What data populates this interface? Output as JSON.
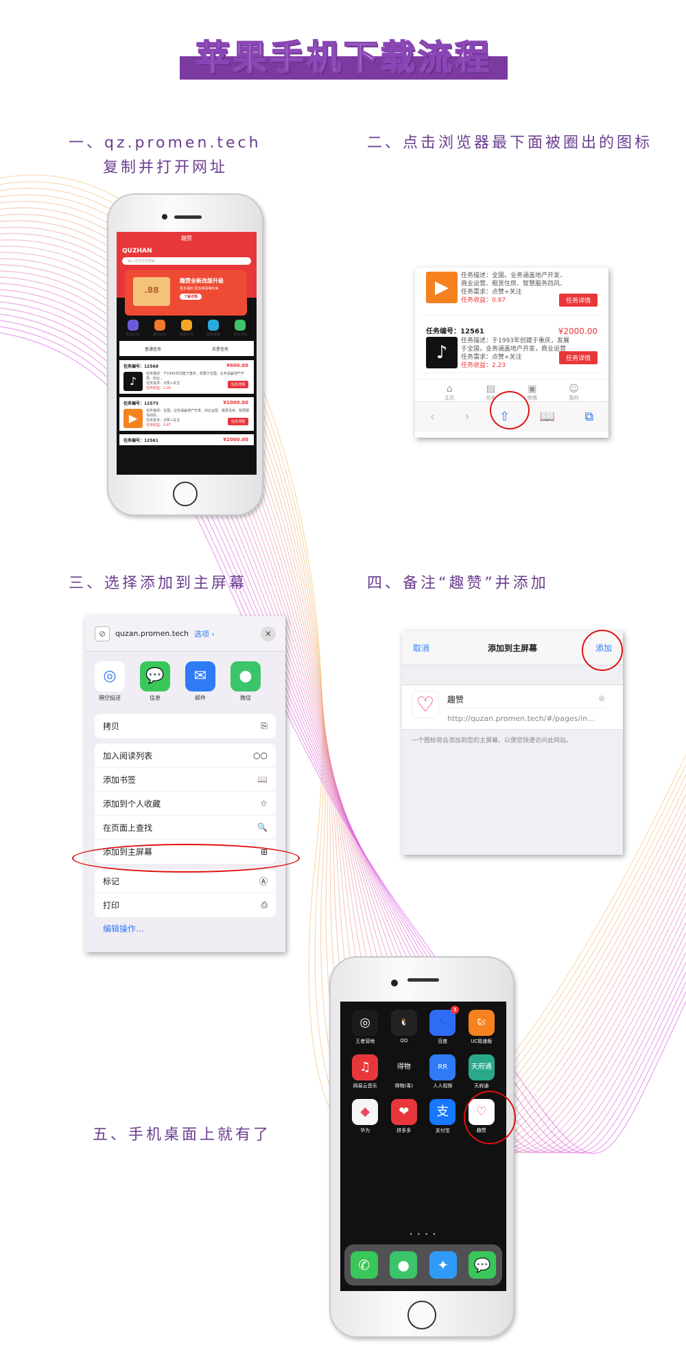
{
  "title": "苹果手机下载流程",
  "steps": {
    "s1a": "一、qz.promen.tech",
    "s1b": "复制并打开网址",
    "s2": "二、点击浏览器最下面被圈出的图标",
    "s3": "三、选择添加到主屏幕",
    "s4": "四、备注“趣赞”并添加",
    "s5": "五、手机桌面上就有了"
  },
  "phone1": {
    "header_title": "趣赞",
    "brand": "QUZHAN",
    "search_placeholder": "输入任务名称搜索",
    "banner_title": "趣赞全新改版升级",
    "banner_sub": "更多福利 更多惊喜等你来",
    "banner_btn": "了解详情",
    "banner_box": ".88",
    "icons": [
      {
        "label": "新闻公告",
        "color": "#6a5bd8"
      },
      {
        "label": "邀请好友",
        "color": "#f07a2c"
      },
      {
        "label": "赛趣专场",
        "color": "#f5a623"
      },
      {
        "label": "联系客服",
        "color": "#29a9e0"
      },
      {
        "label": "更多活动",
        "color": "#3cc46a"
      }
    ],
    "tabs": [
      "普通任务",
      "巨星任务"
    ],
    "tasks": [
      {
        "no": "任务编号：12568",
        "price": "¥600.00",
        "d1": "任务描述：于1993年创建于重庆，发展于全国，业务涵盖地产开发、商业...",
        "d2": "任务需求：点赞+关注",
        "d3": "任务收益：1.00",
        "btn": "任务详情",
        "icon": "♪",
        "color": "#111"
      },
      {
        "no": "任务编号：12575",
        "price": "¥1000.00",
        "d1": "任务描述：全国。业务涵盖地产开发、商业运营、租赁住房、智慧服务四风...",
        "d2": "任务需求：点赞+关注",
        "d3": "任务收益：0.87",
        "btn": "任务详情",
        "icon": "▶",
        "color": "#f5821f"
      },
      {
        "no": "任务编号：12561",
        "price": "¥2000.00"
      }
    ]
  },
  "panel2": {
    "tasks": [
      {
        "d1": "任务描述：全国。业务涵盖地产开发、",
        "d1b": "商业运营、租赁住房、智慧服务四风、",
        "d2": "任务需求：点赞+关注",
        "d3": "任务收益：0.87",
        "btn": "任务详情",
        "icon": "▶",
        "color": "#f5821f"
      },
      {
        "no": "任务编号：12561",
        "price": "¥2000.00",
        "d1": "任务描述：于1993年创建于重庆，发展",
        "d1b": "于全国，业务涵盖地产开发，商业运营",
        "d2": "任务需求：点赞+关注",
        "d3": "任务收益：2.23",
        "btn": "任务详情",
        "icon": "♪",
        "color": "#111"
      }
    ],
    "nav": [
      "主页",
      "任务",
      "商城",
      "我的"
    ],
    "browser": {
      "back": "‹",
      "fwd": "›",
      "share": "⇧",
      "books": "📖",
      "tabs": "⧉"
    }
  },
  "panel3": {
    "url": "quzan.promen.tech",
    "options": "选项 ›",
    "close": "✕",
    "apps": [
      {
        "label": "隔空投送",
        "icon": "◎",
        "color": "#2f7bf6"
      },
      {
        "label": "信息",
        "icon": "💬",
        "color": "#39c75a"
      },
      {
        "label": "邮件",
        "icon": "✉",
        "color": "#2f7bf6"
      },
      {
        "label": "微信",
        "icon": "●",
        "color": "#3cc46a"
      }
    ],
    "g1": [
      {
        "label": "拷贝",
        "icon": "⎘"
      }
    ],
    "g2": [
      {
        "label": "加入阅读列表",
        "icon": "○○"
      },
      {
        "label": "添加书签",
        "icon": "📖"
      },
      {
        "label": "添加到个人收藏",
        "icon": "☆"
      },
      {
        "label": "在页面上查找",
        "icon": "🔍"
      },
      {
        "label": "添加到主屏幕",
        "icon": "⊞"
      }
    ],
    "g3": [
      {
        "label": "标记",
        "icon": "Ⓐ"
      },
      {
        "label": "打印",
        "icon": "⎙"
      }
    ],
    "edit": "编辑操作..."
  },
  "panel4": {
    "cancel": "取消",
    "title": "添加到主屏幕",
    "add": "添加",
    "name": "趣赞",
    "url": "http://quzan.promen.tech/#/pages/in...",
    "hint": "一个图标将会添加到您的主屏幕，以便您快速访问此网站。"
  },
  "phone2": {
    "apps": [
      {
        "label": "王者营地",
        "icon": "◎",
        "color": "#1b1b1b"
      },
      {
        "label": "QQ",
        "icon": "🐧",
        "color": "#222"
      },
      {
        "label": "百度",
        "icon": "🐾",
        "color": "#2f6cf6",
        "badge": "1"
      },
      {
        "label": "UC极速版",
        "icon": "🐿",
        "color": "#f5821f"
      },
      {
        "label": "网易云音乐",
        "icon": "♫",
        "color": "#e8373a"
      },
      {
        "label": "得物(毒)",
        "icon": "得物",
        "color": "#111"
      },
      {
        "label": "人人视频",
        "icon": "RR",
        "color": "#2f7bf6"
      },
      {
        "label": "天府通",
        "icon": "天府通",
        "color": "#2aa88a"
      },
      {
        "label": "华为",
        "icon": "◆",
        "color": "#f6f6f6"
      },
      {
        "label": "拼多多",
        "icon": "❤",
        "color": "#e8373a"
      },
      {
        "label": "支付宝",
        "icon": "支",
        "color": "#1677ff"
      },
      {
        "label": "趣赞",
        "icon": "♡",
        "color": "#ffffff"
      }
    ],
    "dock": [
      {
        "icon": "✆",
        "color": "#39c75a"
      },
      {
        "icon": "●",
        "color": "#3cc46a"
      },
      {
        "icon": "✦",
        "color": "#2f9bf6"
      },
      {
        "icon": "💬",
        "color": "#39c75a"
      }
    ],
    "dots": "• • • •"
  },
  "colors": {
    "accent": "#7b3aa0",
    "step_text": "#6b3d8f",
    "red": "#e8373a",
    "circle": "#e01010",
    "ios_blue": "#2f7bf6"
  }
}
